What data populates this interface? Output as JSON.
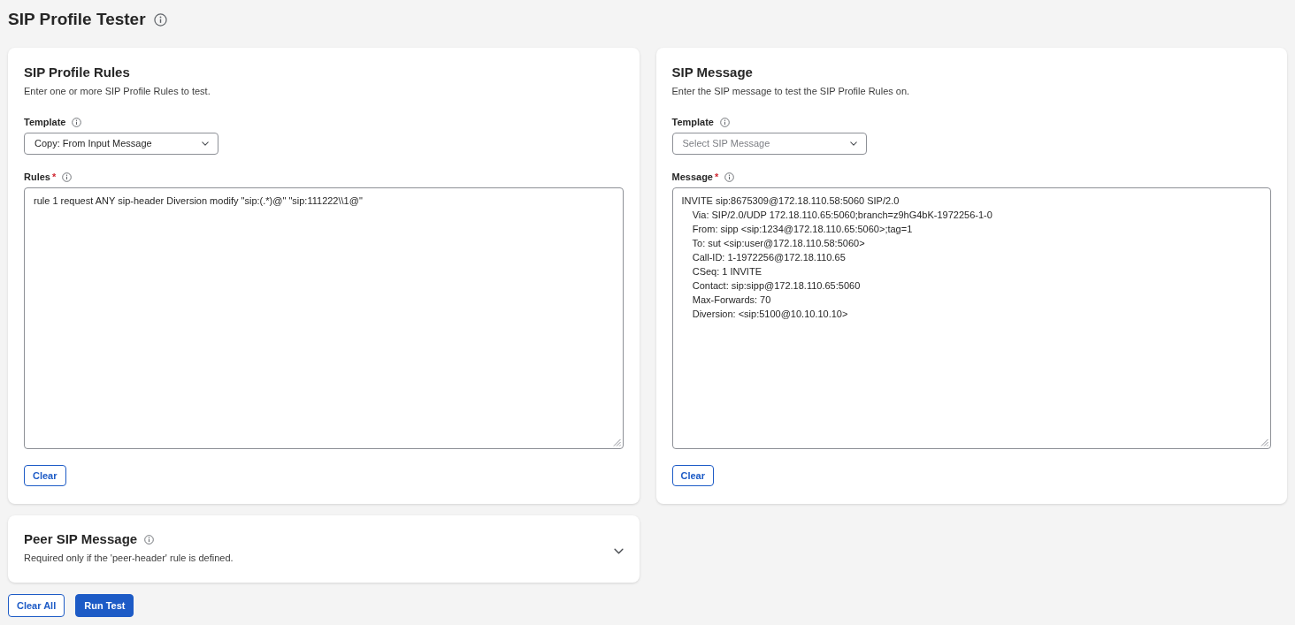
{
  "page": {
    "title": "SIP Profile Tester"
  },
  "panels": [
    {
      "title": "SIP Profile Rules",
      "description": "Enter one or more SIP Profile Rules to test.",
      "template": {
        "label": "Template",
        "value": "Copy: From Input Message"
      },
      "editor": {
        "label": "Rules",
        "required_mark": "*",
        "value": "rule 1 request ANY sip-header Diversion modify \"sip:(.*)@\" \"sip:111222\\\\1@\""
      },
      "clear_button": "Clear"
    },
    {
      "title": "SIP Message",
      "description": "Enter the SIP message to test the SIP Profile Rules on.",
      "template": {
        "label": "Template",
        "placeholder": "Select SIP Message"
      },
      "editor": {
        "label": "Message",
        "required_mark": "*",
        "value": "INVITE sip:8675309@172.18.110.58:5060 SIP/2.0\n    Via: SIP/2.0/UDP 172.18.110.65:5060;branch=z9hG4bK-1972256-1-0\n    From: sipp <sip:1234@172.18.110.65:5060>;tag=1\n    To: sut <sip:user@172.18.110.58:5060>\n    Call-ID: 1-1972256@172.18.110.65\n    CSeq: 1 INVITE\n    Contact: sip:sipp@172.18.110.65:5060\n    Max-Forwards: 70\n    Diversion: <sip:5100@10.10.10.10>"
      },
      "clear_button": "Clear"
    }
  ],
  "peer_panel": {
    "title": "Peer SIP Message",
    "description": "Required only if the 'peer-header' rule is defined.",
    "expanded": false
  },
  "actions": [
    {
      "label": "Clear All",
      "kind": "secondary"
    },
    {
      "label": "Run Test",
      "kind": "primary"
    }
  ]
}
